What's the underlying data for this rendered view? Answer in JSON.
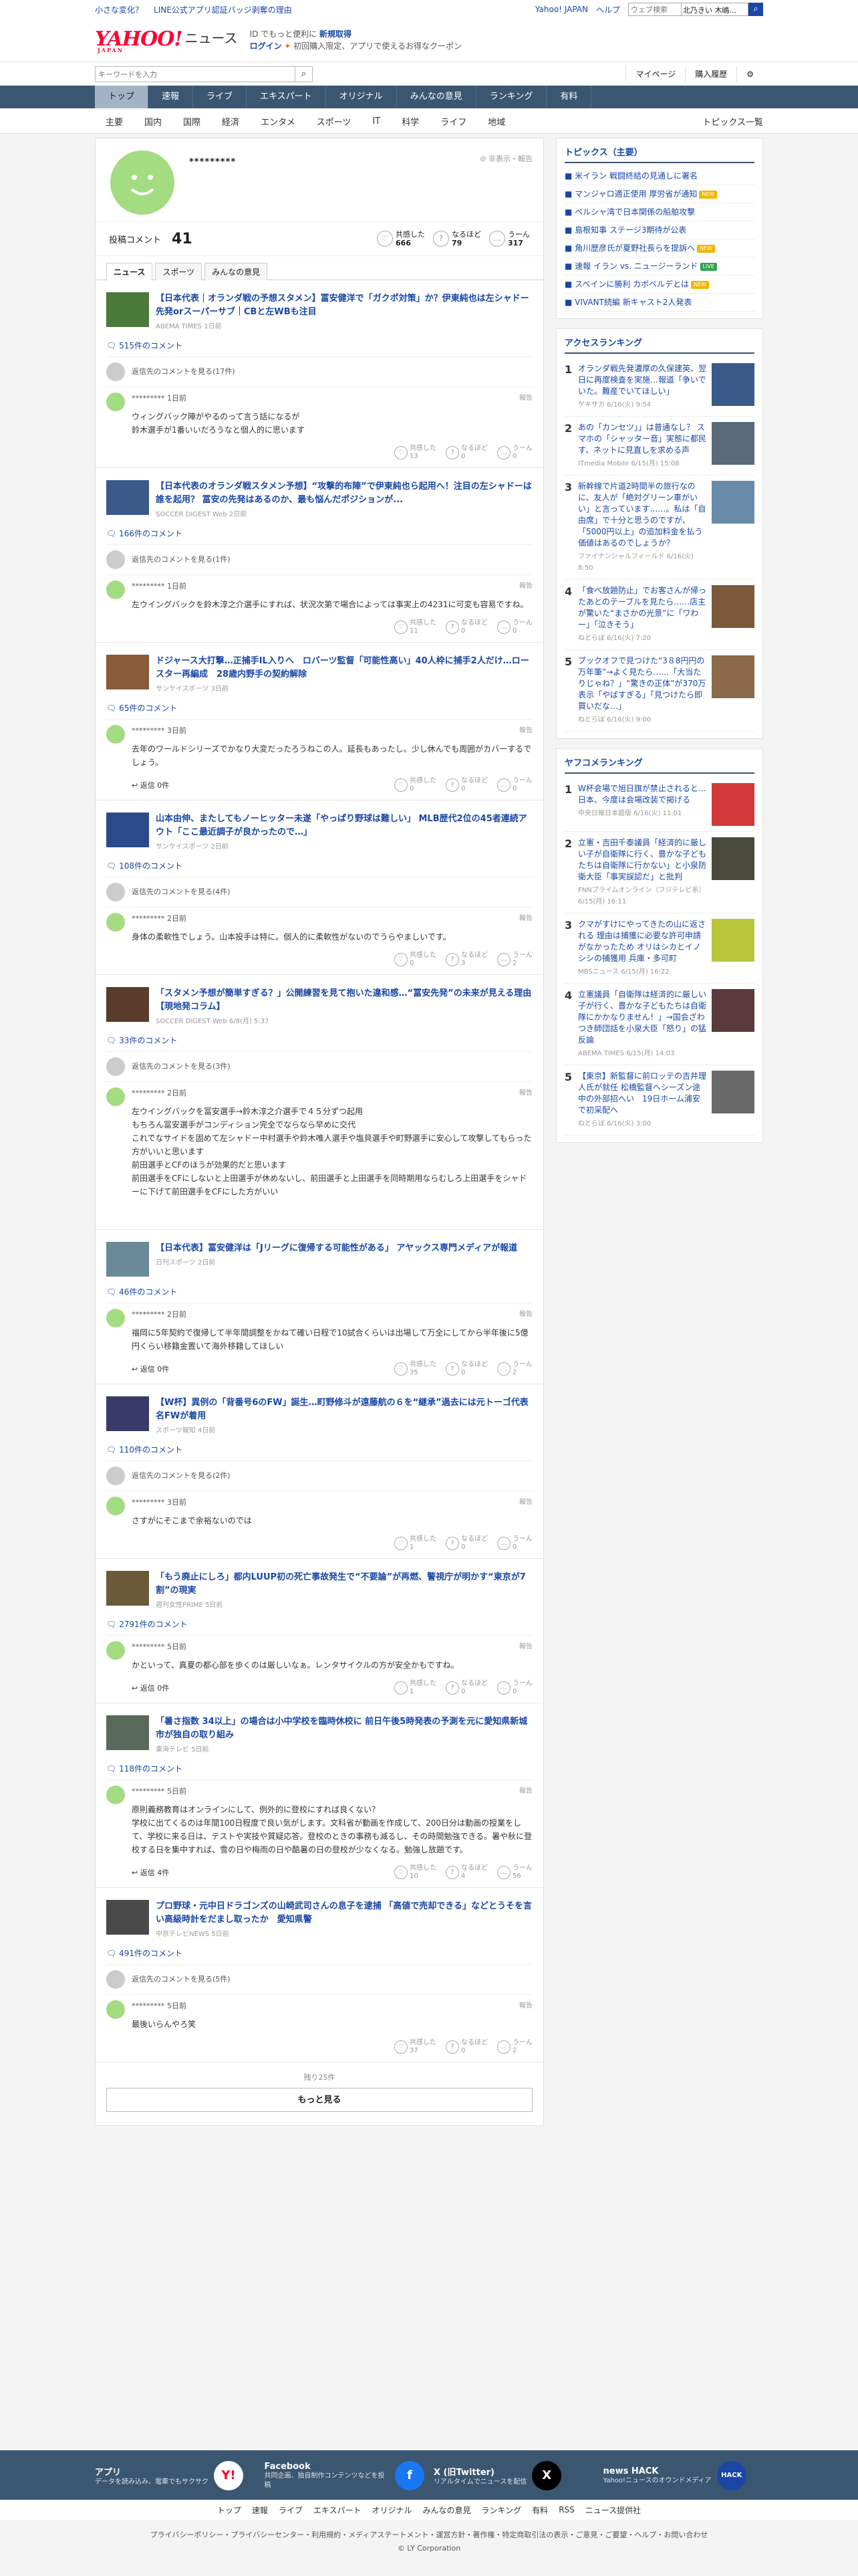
{
  "topbar": {
    "left1": "小さな変化？",
    "left2": "LINE公式アプリ認証バッジ剥奪の理由",
    "right1": "Yahoo! JAPAN",
    "right2": "ヘルプ",
    "search_placeholder": "ウェブ検索",
    "location": "北乃きい 木嶋..."
  },
  "header": {
    "logo": "YAHOO!",
    "logo_sub": "JAPAN",
    "news": "ニュース",
    "promo1_a": "ID でもっと便利に",
    "promo1_b": "新規取得",
    "promo2_a": "ログイン",
    "promo2_b": "初回購入限定、アプリで使えるお得なクーポン"
  },
  "search": {
    "placeholder": "キーワードを入力",
    "mypage": "マイページ",
    "history": "購入履歴"
  },
  "mainnav": [
    "トップ",
    "速報",
    "ライブ",
    "エキスパート",
    "オリジナル",
    "みんなの意見",
    "ランキング",
    "有料"
  ],
  "subnav": [
    "主要",
    "国内",
    "国際",
    "経済",
    "エンタメ",
    "スポーツ",
    "IT",
    "科学",
    "ライフ",
    "地域"
  ],
  "subnav_right": "トピックス一覧",
  "profile": {
    "name": "*********",
    "report": "非表示・報告",
    "label": "投稿コメント",
    "count": "41",
    "rx": [
      {
        "l": "共感した",
        "v": "666"
      },
      {
        "l": "なるほど",
        "v": "79"
      },
      {
        "l": "うーん",
        "v": "317"
      }
    ]
  },
  "tabs": [
    "ニュース",
    "スポーツ",
    "みんなの意見"
  ],
  "labels": {
    "other": "返信先のコメントを見る",
    "report": "報告",
    "reply": "返信",
    "r1": "共感した",
    "r2": "なるほど",
    "r3": "うーん"
  },
  "entries": [
    {
      "title": "【日本代表｜オランダ戦の予想スタメン】冨安健洋で「ガクポ対策」か？伊東純也は左シャドー先発orスーパーサブ｜CBと左WBも注目",
      "src": "ABEMA TIMES 1日前",
      "cc": "515件のコメント",
      "other": "返信先のコメントを見る(17件)",
      "user": "********* 1日前",
      "body": "ウィングバック陣がやるのって言う話になるが\n鈴木選手が1番いいだろうなと個人的に思います",
      "reply": "",
      "r": [
        "13",
        "0",
        "0"
      ]
    },
    {
      "title": "【日本代表のオランダ戦スタメン予想】“攻撃的布陣”で伊東純也ら起用へ！注目の左シャドーは誰を起用？ 冨安の先発はあるのか、最も悩んだポジションが...",
      "src": "SOCCER DIGEST Web 2日前",
      "cc": "166件のコメント",
      "other": "返信先のコメントを見る(1件)",
      "user": "********* 1日前",
      "body": "左ウイングバックを鈴木淳之介選手にすれば、状況次第で場合によっては事実上の4231に可変も容易ですね。",
      "reply": "",
      "r": [
        "11",
        "0",
        "0"
      ]
    },
    {
      "title": "ドジャース大打撃…正捕手IL入りへ　ロバーツ監督「可能性高い」40人枠に捕手2人だけ…ロースター再編成　28歳内野手の契約解除",
      "src": "サンケイスポーツ 3日前",
      "cc": "65件のコメント",
      "other": "",
      "user": "********* 3日前",
      "body": "去年のワールドシリーズでかなり大変だったろうねこの人。延長もあったし。少し休んでも周囲がカバーするでしょう。",
      "reply": "返信 0件",
      "r": [
        "0",
        "0",
        "0"
      ]
    },
    {
      "title": "山本由伸、またしてもノーヒッター未遂「やっぱり野球は難しい」 MLB歴代2位の45者連続アウト「ここ最近調子が良かったので…」",
      "src": "サンケイスポーツ 2日前",
      "cc": "108件のコメント",
      "other": "返信先のコメントを見る(4件)",
      "user": "********* 2日前",
      "body": "身体の柔軟性でしょう。山本投手は特に。個人的に柔軟性がないのでうらやましいです。",
      "reply": "",
      "r": [
        "0",
        "3",
        "2"
      ]
    },
    {
      "title": "「スタメン予想が簡単すぎる？」公開練習を見て抱いた違和感…“冨安先発”の未来が見える理由【現地発コラム】",
      "src": "SOCCER DIGEST Web 6/8(月) 5:37",
      "cc": "33件のコメント",
      "other": "返信先のコメントを見る(3件)",
      "user": "********* 2日前",
      "body": "左ウイングバックを冨安選手→鈴木淳之介選手で４５分ずつ起用\nもちろん冨安選手がコンディション完全でならなら早めに交代\nこれでなサイドを固めて左シャドー中村選手や鈴木唯人選手や塩貝選手や町野選手に安心して攻撃してもらった方がいいと思います\n前田選手とCFのほうが効果的だと思います\n前田選手をCFにしないと上田選手が休めないし、前田選手と上田選手を同時期用ならむしろ上田選手をシャドーに下げて前田選手をCFにした方がいい",
      "reply": "",
      "r": [
        "",
        "",
        ""
      ]
    },
    {
      "title": "【日本代表】冨安健洋は「Jリーグに復帰する可能性がある」 アヤックス専門メディアが報道",
      "src": "日刊スポーツ 2日前",
      "cc": "46件のコメント",
      "other": "",
      "user": "********* 2日前",
      "body": "福岡に5年契約で復帰して半年間調整をかねて確い日程で10試合くらいは出場して万全にしてから半年後に5億円くらい移籍金置いて海外移籍してほしい",
      "reply": "返信 0件",
      "r": [
        "35",
        "0",
        "2"
      ]
    },
    {
      "title": "【W杯】異例の「背番号6のFW」誕生…町野修斗が遠藤航の６を“継承”過去には元トーゴ代表名FWが着用",
      "src": "スポーツ報知 4日前",
      "cc": "110件のコメント",
      "other": "返信先のコメントを見る(2件)",
      "user": "********* 3日前",
      "body": "さすがにそこまで余裕ないのでは",
      "reply": "",
      "r": [
        "1",
        "0",
        "0"
      ]
    },
    {
      "title": "「もう廃止にしろ」都内LUUP初の死亡事故発生で“不要論”が再燃、警視庁が明かす“東京が7割”の現実",
      "src": "週刊女性PRIME 5日前",
      "cc": "2791件のコメント",
      "other": "",
      "user": "********* 5日前",
      "body": "かといって、真夏の都心部を歩くのは厳しいなぁ。レンタサイクルの方が安全かもですね。",
      "reply": "返信 0件",
      "r": [
        "1",
        "0",
        "0"
      ]
    },
    {
      "title": "「暑さ指数 34以上」の場合は小中学校を臨時休校に 前日午後5時発表の予測を元に愛知県新城市が独自の取り組み",
      "src": "東海テレビ 5日前",
      "cc": "118件のコメント",
      "other": "",
      "user": "********* 5日前",
      "body": "原則義務教育はオンラインにして、例外的に登校にすれば良くない？\n学校に出てくるのは年間100日程度で良い気がします。文科省が動画を作成して、200日分は動画の授業をして、学校に来る日は、テストや実技や質疑応答。登校のときの事務も減るし、その時間勉強できる。暑や秋に登校する日を集中すれば、雪の日や梅雨の日や酷暑の日の登校が少なくなる。勉強し放題です。",
      "reply": "返信 4件",
      "r": [
        "10",
        "4",
        "56"
      ]
    },
    {
      "title": "プロ野球・元中日ドラゴンズの山崎武司さんの息子を逮捕 「高値で売却できる」などとうそを言い高級時計をだまし取ったか　愛知県警",
      "src": "中京テレビNEWS 5日前",
      "cc": "491件のコメント",
      "other": "返信先のコメントを見る(5件)",
      "user": "********* 5日前",
      "body": "最後いらんやろ笑",
      "reply": "",
      "r": [
        "37",
        "0",
        "2"
      ]
    }
  ],
  "more": {
    "count": "残り25件",
    "btn": "もっと見る"
  },
  "side": {
    "topics_h": "トピックス（主要）",
    "topics": [
      {
        "t": "米イラン 戦闘終結の見通しに署名",
        "b": ""
      },
      {
        "t": "マンジャロ適正使用 厚労省が通知",
        "b": "new"
      },
      {
        "t": "ベルシャ湾で日本関係の船舶攻撃",
        "b": ""
      },
      {
        "t": "島根知事 ステージ3期待が公表",
        "b": ""
      },
      {
        "t": "角川歴彦氏が夏野社長らを提訴へ",
        "b": "new"
      },
      {
        "t": "速報 イラン vs. ニュージーランド",
        "b": "live"
      },
      {
        "t": "スペインに勝利 カボベルデとは",
        "b": "new"
      },
      {
        "t": "VIVANT続編 新キャスト2人発表",
        "b": ""
      }
    ],
    "badge_new": "NEW",
    "badge_live": "LIVE",
    "access_h": "アクセスランキング",
    "access": [
      {
        "n": "1",
        "t": "オランダ戦先発濃厚の久保建英、翌日に再度検査を実施…報道「争いでいた。難産でいてほしい」",
        "m": "ゲキサカ 6/16(火) 9:54"
      },
      {
        "n": "2",
        "t": "あの「カンセツ」」は普通なし？ スマホの「シャッター音」実態に都民す、ネットに見直しを求める声",
        "m": "ITmedia Mobile 6/15(月) 15:08"
      },
      {
        "n": "3",
        "t": "新幹線で片道2時間半の旅行なのに、友人が「絶対グリーン車がいい」と言っています……。私は「自由席」で十分と思うのですが、「5000円以上」の追加料金を払う価値はあるのでしょうか？",
        "m": "ファイナンシャルフィールド 6/16(火) 8:50"
      },
      {
        "n": "4",
        "t": "「食べ放題防止」でお客さんが帰ったあとのテーブルを見たら……店主が驚いた“まさかの光景”に「ワわー」「泣きそう」",
        "m": "ねとらぼ 6/16(火) 7:20"
      },
      {
        "n": "5",
        "t": "ブックオフで見つけた“3８8円円の万年筆”→よく見たら……「大当たりじゃね？」“驚きの正体”が370万表示「やばすぎる」「見つけたら即買いだな…」",
        "m": "ねとらぼ 6/16(火) 9:00"
      }
    ],
    "yafuko_h": "ヤフコメランキング",
    "yafuko": [
      {
        "n": "1",
        "t": "W杯会場で旭日旗が禁止されると…日本、今度は会場改装で掲げる",
        "m": "中央日報日本語版 6/16(火) 11:01"
      },
      {
        "n": "2",
        "t": "立憲・吉田千泰議員「経済的に厳しい子が自衛隊に行く、豊かな子どもたちは自衛隊に行かない」と小泉防衛大臣「事実誤認だ」と批判",
        "m": "FNNプライムオンライン（フジテレビ系） 6/15(月) 16:11"
      },
      {
        "n": "3",
        "t": "クマがすけにやってきたの山に返される 理由は捕獲に必要な許可申請がなかったため オリはシカとイノシシの捕獲用 兵庫・多可町",
        "m": "MBSニュース 6/15(月) 16:22"
      },
      {
        "n": "4",
        "t": "立憲議員「自衛隊は経済的に厳しい子が行く、豊かな子どもたちは自衛隊にかかなりません！」→国会ざわつき師団話を小泉大臣「怒り」の猛反論",
        "m": "ABEMA TIMES 6/15(月) 14:03"
      },
      {
        "n": "5",
        "t": "【東京】新監督に前ロッテの吉井理人氏が就任 松橋監督へシーズン途中の外部招へい　19日ホーム浦安で初采配へ",
        "m": "ねとらぼ 6/16(火) 3:00"
      }
    ]
  },
  "footer": {
    "apps": [
      {
        "t": "アプリ",
        "d": "データを読み込み、電車でもサクサク",
        "icon": "Y!"
      },
      {
        "t": "Facebook",
        "d": "共同企画、独自制作コンテンツなどを投稿",
        "icon": "f"
      },
      {
        "t": "X (旧Twitter)",
        "d": "リアルタイムでニュースを配信",
        "icon": "X"
      },
      {
        "t": "news HACK",
        "d": "Yahoo!ニュースのオウンドメディア",
        "icon": "HACK"
      }
    ],
    "nav": [
      "トップ",
      "速報",
      "ライブ",
      "エキスパート",
      "オリジナル",
      "みんなの意見",
      "ランキング",
      "有料",
      "RSS",
      "ニュース提供社"
    ],
    "legal": "プライバシーポリシー・プライバシーセンター・利用規約・メディアステートメント・運営方針・著作権・特定商取引法の表示・ご意見・ご要望・ヘルプ・お問い合わせ",
    "copy": "© LY Corporation"
  },
  "colors": {
    "accent": "#1a47a6",
    "nav": "#3b5670",
    "logo": "#ff0033",
    "avatar": "#a4dc82"
  }
}
